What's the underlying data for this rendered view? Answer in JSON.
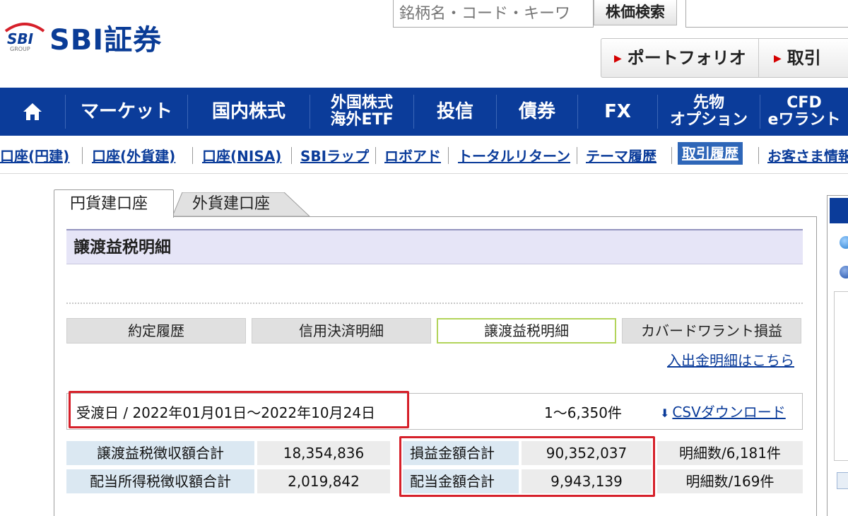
{
  "header": {
    "logo_text": "SBI証券",
    "logo_mark_text": "SBI",
    "logo_mark_sub": "GROUP",
    "search_placeholder": "銘柄名・コード・キーワ",
    "search_button": "株価検索",
    "portfolio_button": "ポートフォリオ",
    "trade_button": "取引"
  },
  "main_nav": [
    {
      "lines": [
        "マーケット"
      ]
    },
    {
      "lines": [
        "国内株式"
      ]
    },
    {
      "lines": [
        "外国株式",
        "海外ETF"
      ]
    },
    {
      "lines": [
        "投信"
      ]
    },
    {
      "lines": [
        "債券"
      ]
    },
    {
      "lines": [
        "FX"
      ]
    },
    {
      "lines": [
        "先物",
        "オプション"
      ]
    },
    {
      "lines": [
        "CFD",
        "eワラント"
      ]
    }
  ],
  "sub_nav": [
    {
      "label": "口座(円建)",
      "active": false
    },
    {
      "label": "口座(外貨建)",
      "active": false
    },
    {
      "label": "口座(NISA)",
      "active": false
    },
    {
      "label": "SBIラップ",
      "active": false
    },
    {
      "label": "ロボアド",
      "active": false
    },
    {
      "label": "トータルリターン",
      "active": false
    },
    {
      "label": "テーマ履歴",
      "active": false
    },
    {
      "label": "取引履歴",
      "active": true
    },
    {
      "label": "お客さま情報",
      "active": false
    }
  ],
  "account_tabs": {
    "yen": "円貨建口座",
    "foreign": "外貨建口座"
  },
  "section_title": "譲渡益税明細",
  "sub_tabs": [
    {
      "label": "約定履歴",
      "active": false
    },
    {
      "label": "信用決済明細",
      "active": false
    },
    {
      "label": "譲渡益税明細",
      "active": true
    },
    {
      "label": "カバードワラント損益",
      "active": false
    }
  ],
  "deposit_link": "入出金明細はこちら",
  "date_range": "受渡日 / 2022年01月01日～2022年10月24日",
  "count": "1～6,350件",
  "csv_download": "CSVダウンロード",
  "summary": {
    "row1": {
      "tax_label": "譲渡益税徴収額合計",
      "tax_value": "18,354,836",
      "amount_label": "損益金額合計",
      "amount_value": "90,352,037",
      "detail": "明細数/6,181件"
    },
    "row2": {
      "tax_label": "配当所得税徴収額合計",
      "tax_value": "2,019,842",
      "amount_label": "配当金額合計",
      "amount_value": "9,943,139",
      "detail": "明細数/169件"
    }
  },
  "colors": {
    "brand_navy": "#0b3c9a",
    "highlight_red": "#d6202a",
    "section_bg": "#e6e5f7",
    "label_blue": "#dbe8f2",
    "active_tab_border": "#b2d45a"
  },
  "icons": [
    "home-icon",
    "triangle-right-icon",
    "download-arrow-icon"
  ]
}
